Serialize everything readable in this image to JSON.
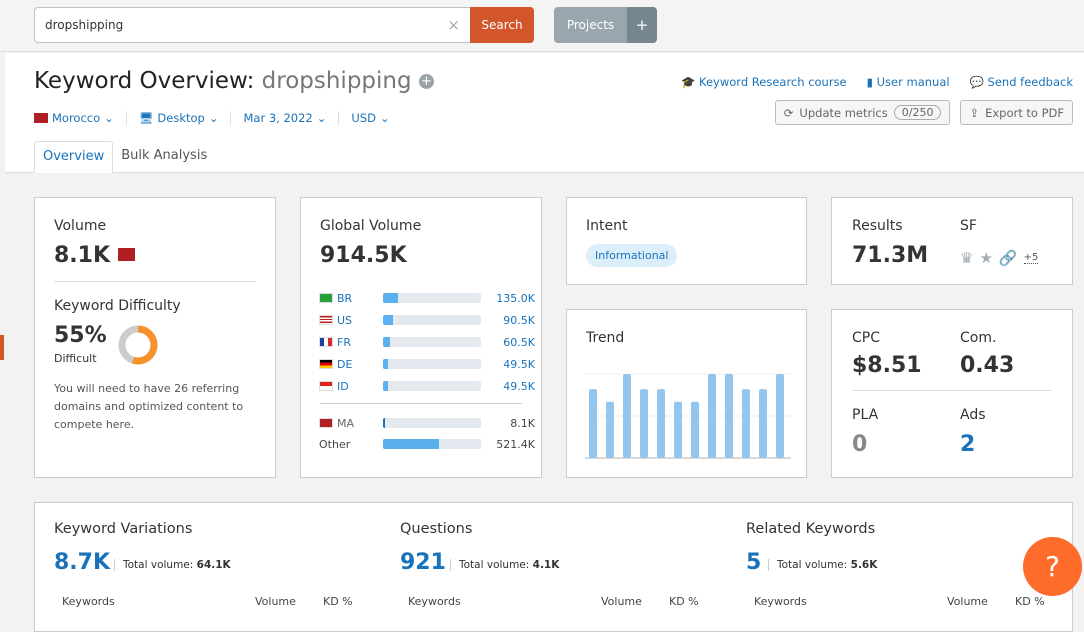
{
  "search": {
    "value": "dropshipping",
    "button": "Search",
    "clear_icon": "close-icon"
  },
  "projects": {
    "label": "Projects",
    "plus": "+"
  },
  "header": {
    "title": "Keyword Overview:",
    "keyword": "dropshipping",
    "add": "+"
  },
  "filters": {
    "country": "Morocco",
    "device": "Desktop",
    "date": "Mar 3, 2022",
    "currency": "USD"
  },
  "links": {
    "course": "Keyword Research course",
    "manual": "User manual",
    "feedback": "Send feedback"
  },
  "buttons": {
    "update": "Update metrics",
    "update_count": "0/250",
    "export": "Export to PDF"
  },
  "tabs": [
    "Overview",
    "Bulk Analysis"
  ],
  "volume": {
    "label": "Volume",
    "value": "8.1K"
  },
  "kd": {
    "label": "Keyword Difficulty",
    "value": "55%",
    "level": "Difficult",
    "percent": 55,
    "note": "You will need to have 26 referring domains and optimized content to compete here."
  },
  "global": {
    "label": "Global Volume",
    "value": "914.5K",
    "countries": [
      {
        "code": "BR",
        "value": "135.0K",
        "fill": 0.15
      },
      {
        "code": "US",
        "value": "90.5K",
        "fill": 0.1
      },
      {
        "code": "FR",
        "value": "60.5K",
        "fill": 0.07
      },
      {
        "code": "DE",
        "value": "49.5K",
        "fill": 0.055
      },
      {
        "code": "ID",
        "value": "49.5K",
        "fill": 0.055
      }
    ],
    "local": {
      "code": "MA",
      "value": "8.1K",
      "fill": 0.02
    },
    "other": {
      "label": "Other",
      "value": "521.4K",
      "fill": 0.57
    }
  },
  "intent": {
    "label": "Intent",
    "value": "Informational"
  },
  "trend": {
    "label": "Trend",
    "values": [
      0.82,
      0.67,
      1,
      0.82,
      0.82,
      0.67,
      0.67,
      1,
      1,
      0.82,
      0.82,
      1
    ]
  },
  "results": {
    "label": "Results",
    "value": "71.3M",
    "sf_label": "SF",
    "sf_more": "+5"
  },
  "cpc": {
    "label": "CPC",
    "value": "$8.51",
    "com_label": "Com.",
    "com_value": "0.43",
    "pla_label": "PLA",
    "pla_value": "0",
    "ads_label": "Ads",
    "ads_value": "2"
  },
  "sections": [
    {
      "title": "Keyword Variations",
      "count": "8.7K",
      "tv_label": "Total volume:",
      "tv": "64.1K"
    },
    {
      "title": "Questions",
      "count": "921",
      "tv_label": "Total volume:",
      "tv": "4.1K"
    },
    {
      "title": "Related Keywords",
      "count": "5",
      "tv_label": "Total volume:",
      "tv": "5.6K"
    }
  ],
  "columns": {
    "keywords": "Keywords",
    "volume": "Volume",
    "kd": "KD %"
  },
  "colors": {
    "accent": "#1a73ba",
    "search": "#d3552a",
    "help": "#ff6b2b",
    "bar": "#5bb0ef",
    "trend": "#93c6ee"
  }
}
